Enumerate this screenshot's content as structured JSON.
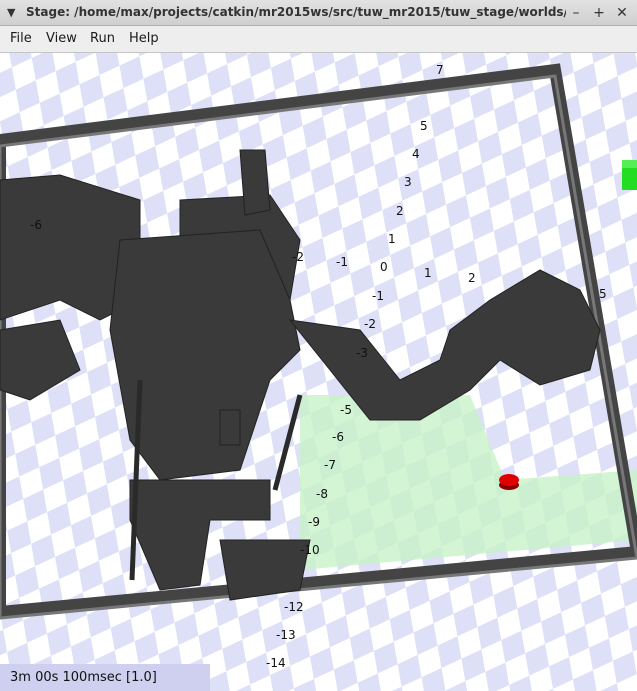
{
  "window": {
    "title": "Stage: /home/max/projects/catkin/mr2015ws/src/tuw_mr2015/tuw_stage/worlds/my_world.world",
    "buttons": {
      "minimize": "–",
      "maximize": "+",
      "close": "✕"
    },
    "menu_glyph": "▼"
  },
  "menubar": {
    "items": [
      {
        "label": "File"
      },
      {
        "label": "View"
      },
      {
        "label": "Run"
      },
      {
        "label": "Help"
      }
    ]
  },
  "world": {
    "axis_labels": [
      "7",
      "5",
      "4",
      "3",
      "2",
      "1",
      "0",
      "-1",
      "-2",
      "-3",
      "-5",
      "-6",
      "-7",
      "-8",
      "-9",
      "-10",
      "-12",
      "-13",
      "-14",
      "1",
      "2",
      "5",
      "-2",
      "-1",
      "-6"
    ],
    "colors": {
      "floor_checker": "#dde0f6",
      "wall": "#555555",
      "obstacles": "#3c3c3c",
      "laser_range": "#c8f2c8",
      "robot": "#e00000",
      "green_box": "#22dd22"
    }
  },
  "status": {
    "text": "3m 00s 100msec [1.0]"
  }
}
